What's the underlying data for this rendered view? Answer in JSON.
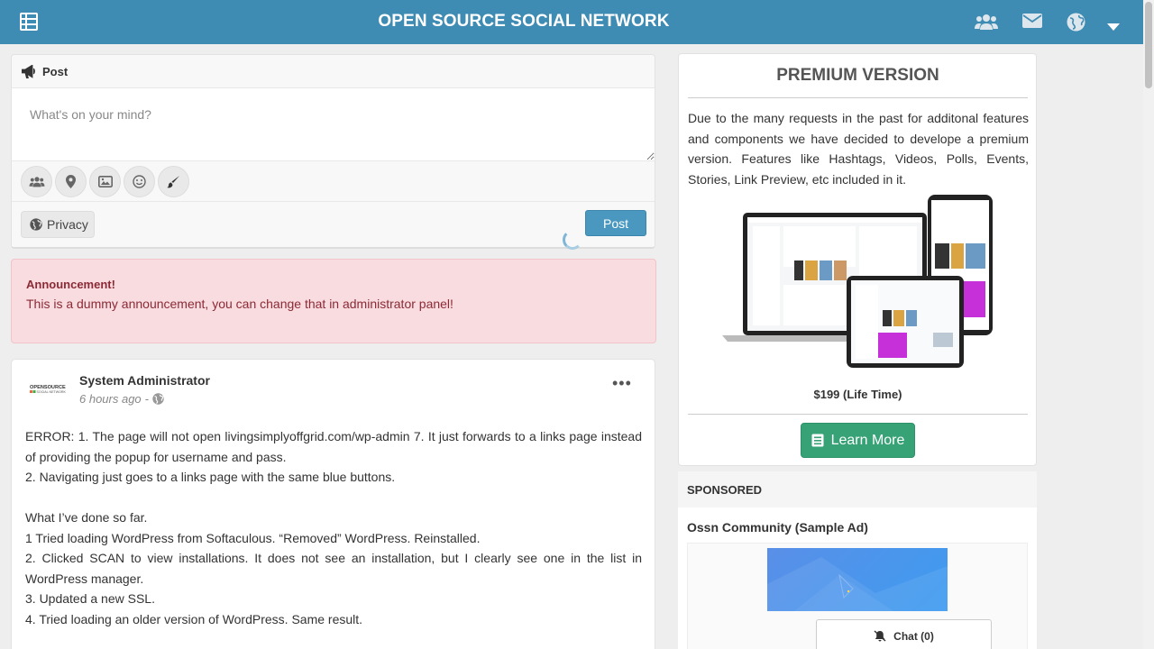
{
  "app": {
    "title": "OPEN SOURCE SOCIAL NETWORK"
  },
  "topbar_icons": [
    "menu-grid-icon",
    "friends-icon",
    "messages-icon",
    "notifications-globe-icon",
    "dropdown-caret-icon"
  ],
  "composer": {
    "header_label": "Post",
    "placeholder": "What's on your mind?",
    "tools": [
      "tag-friends-icon",
      "location-icon",
      "photo-icon",
      "emoji-icon",
      "brush-icon"
    ],
    "privacy_label": "Privacy",
    "post_label": "Post"
  },
  "announcement": {
    "title": "Announcement!",
    "text": "This is a dummy announcement, you can change that in administrator panel!"
  },
  "wallpost": {
    "author": "System Administrator",
    "time": "6 hours ago",
    "separator": "-",
    "lines": [
      "ERROR: 1. The page will not open livingsimplyoffgrid.com/wp-admin 7. It just forwards to a links page instead of providing the popup for username and pass.",
      "2. Navigating just goes to a links page with the same blue buttons.",
      "",
      "What I’ve done so far.",
      "1 Tried loading WordPress from Softaculous. “Removed” WordPress. Reinstalled.",
      "2. Clicked SCAN to view installations. It does not see an installation, but I clearly see one in the list in WordPress manager.",
      "3. Updated a new SSL.",
      "4. Tried loading an older version of WordPress. Same result."
    ]
  },
  "premium": {
    "title": "PREMIUM VERSION",
    "description": "Due to the many requests in the past for additonal features and components we have decided to develope a premium version. Features like Hashtags, Videos, Polls, Events, Stories, Link Preview, etc included in it.",
    "price": "$199 (Life Time)",
    "button_label": "Learn More"
  },
  "sponsored": {
    "header": "SPONSORED",
    "ad_title": "Ossn Community (Sample Ad)"
  },
  "chat": {
    "label": "Chat (0)"
  },
  "colors": {
    "topbar": "#3e8bb3",
    "post_button": "#4a98bf",
    "learn_button": "#36a276",
    "announcement_bg": "#f9dce0"
  }
}
